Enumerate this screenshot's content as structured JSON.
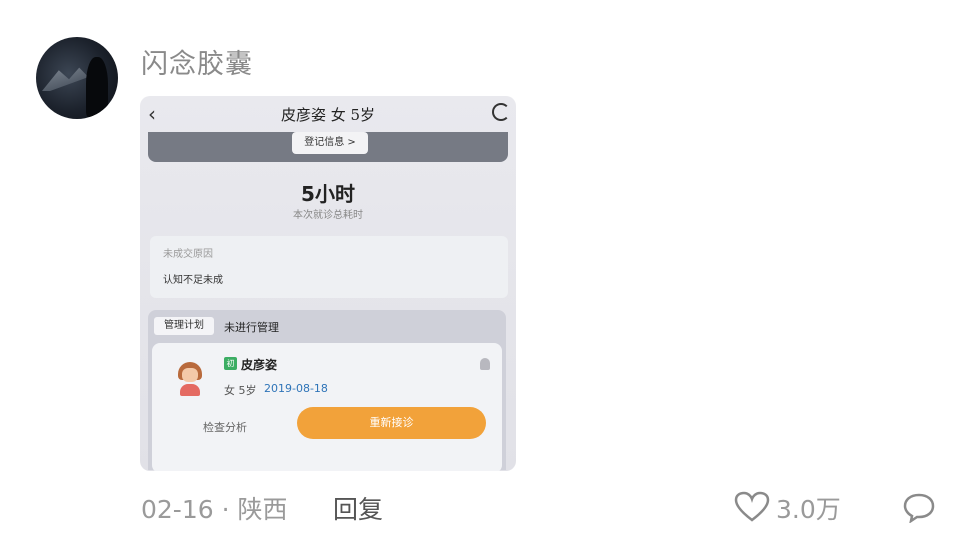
{
  "comment": {
    "username": "闪念胶囊",
    "date_location": "02-16 · 陕西",
    "reply_label": "回复",
    "like_count": "3.0万",
    "icons": {
      "like": "heart-outline-icon",
      "comment": "comment-bubble-icon"
    }
  },
  "photo": {
    "header_title": "皮彦姿 女 5岁",
    "login_info_label": "登记信息 >",
    "total_time": "5小时",
    "total_time_caption": "本次就诊总耗时",
    "reason_label": "未成交原因",
    "reason_value": "认知不足未成",
    "mgmt_tag": "管理计划",
    "mgmt_status": "未进行管理",
    "patient_badge": "初",
    "patient_name": "皮彦姿",
    "patient_gender_age": "女 5岁",
    "patient_dob": "2019-08-18",
    "check_analysis_label": "检查分析",
    "reconsult_label": "重新接诊",
    "accent_color": "#f2a23a",
    "badge_color": "#3cad63"
  }
}
